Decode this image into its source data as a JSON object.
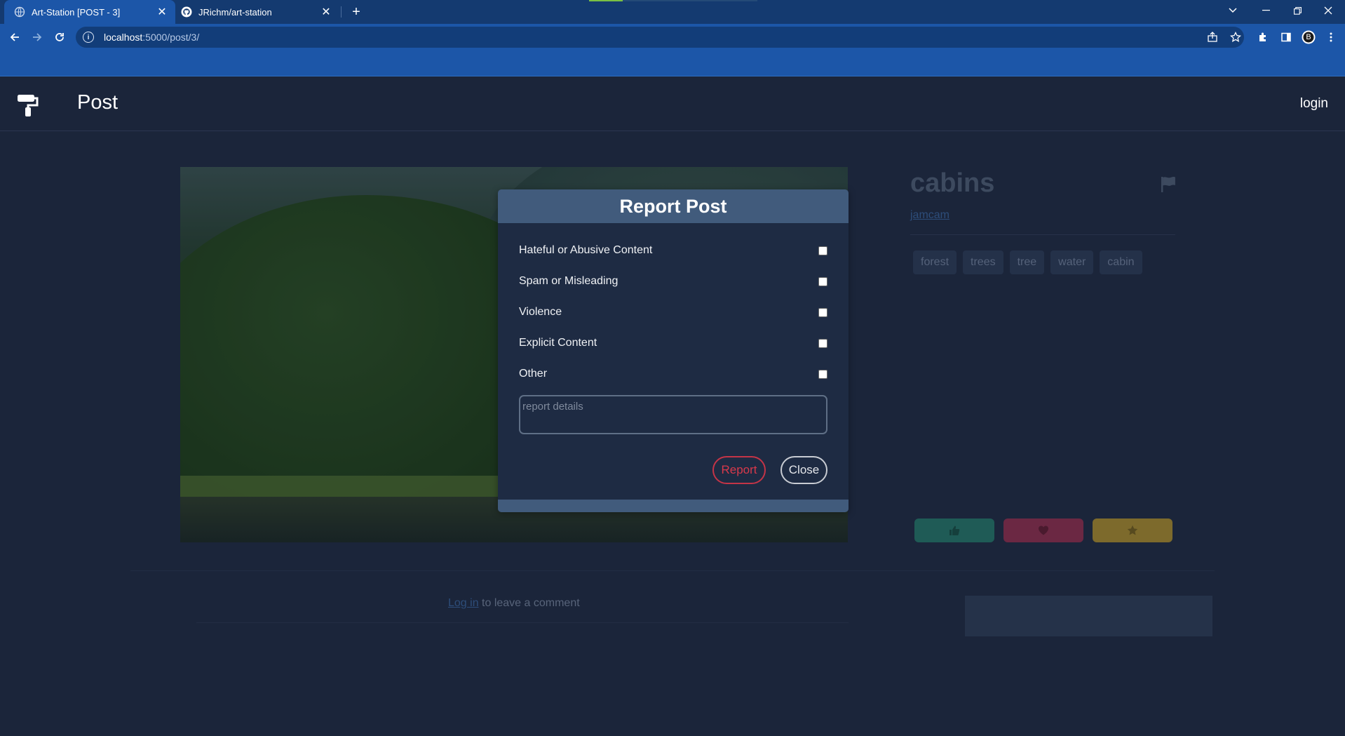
{
  "browser": {
    "tabs": [
      {
        "title": "Art-Station [POST - 3]",
        "active": true,
        "icon": "globe-icon"
      },
      {
        "title": "JRichm/art-station",
        "active": false,
        "icon": "github-icon"
      }
    ],
    "url_host": "localhost",
    "url_path": ":5000/post/3/",
    "profile_initial": "B",
    "window_controls": [
      "tab-search-icon",
      "minimize-icon",
      "restore-icon",
      "close-icon"
    ]
  },
  "site": {
    "page_title": "Post",
    "login_label": "login"
  },
  "post": {
    "title": "cabins",
    "author": "jamcam",
    "tags": [
      "forest",
      "trees",
      "tree",
      "water",
      "cabin"
    ],
    "reactions": [
      {
        "name": "like",
        "icon": "thumbs-up-icon",
        "color": "#1f5b56",
        "icon_color": "#153f3c"
      },
      {
        "name": "love",
        "icon": "heart-icon",
        "color": "#6b2843",
        "icon_color": "#4a1a2e"
      },
      {
        "name": "favorite",
        "icon": "star-icon",
        "color": "#7d6a2c",
        "icon_color": "#574a1f"
      }
    ]
  },
  "comments": {
    "login_link": "Log in",
    "prompt_rest": " to leave a comment"
  },
  "report_modal": {
    "title": "Report Post",
    "options": [
      "Hateful or Abusive Content",
      "Spam or Misleading",
      "Violence",
      "Explicit Content",
      "Other"
    ],
    "details_placeholder": "report details",
    "report_label": "Report",
    "close_label": "Close"
  },
  "colors": {
    "page_bg": "#1b253a",
    "modal_header": "#415b7c",
    "report_accent": "#d8394b",
    "chrome_tab_active": "#1c56a8"
  }
}
